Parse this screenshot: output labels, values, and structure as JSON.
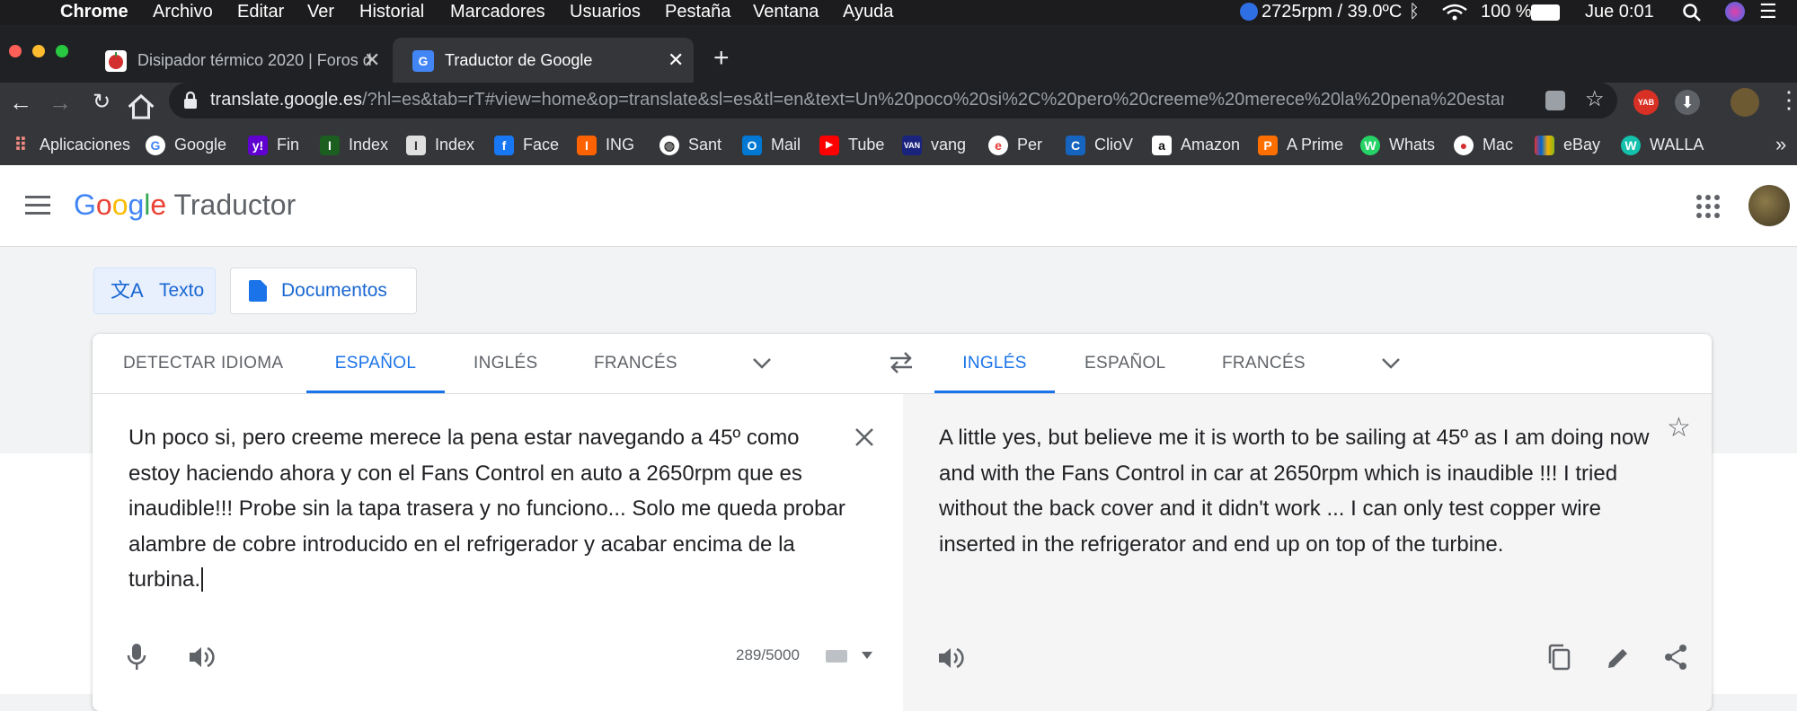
{
  "menubar": {
    "apple": "",
    "app": "Chrome",
    "items": [
      "Archivo",
      "Editar",
      "Ver",
      "Historial",
      "Marcadores",
      "Usuarios",
      "Pestaña",
      "Ventana",
      "Ayuda"
    ],
    "fan_status": "2725rpm / 39.0ºC",
    "battery": "100 %",
    "clock": "Jue 0:01"
  },
  "tabs": [
    {
      "title": "Disipador térmico 2020 | Foros d",
      "active": false
    },
    {
      "title": "Traductor de Google",
      "active": true
    }
  ],
  "address": {
    "host": "translate.google.es",
    "path": "/?hl=es&tab=rT#view=home&op=translate&sl=es&tl=en&text=Un%20poco%20si%2C%20pero%20creeme%20merece%20la%20pena%20estar..."
  },
  "bookmarks": [
    "Aplicaciones",
    "Google",
    "Fin",
    "Index",
    "Index",
    "Face",
    "ING",
    "Sant",
    "Mail",
    "Tube",
    "vang",
    "Per",
    "ClioV",
    "Amazon",
    "A Prime",
    "Whats",
    "Mac",
    "eBay",
    "WALLA"
  ],
  "google": {
    "logo": "Google",
    "product": "Traductor"
  },
  "modes": {
    "text": "Texto",
    "documents": "Documentos"
  },
  "source_langs": [
    "DETECTAR IDIOMA",
    "ESPAÑOL",
    "INGLÉS",
    "FRANCÉS"
  ],
  "target_langs": [
    "INGLÉS",
    "ESPAÑOL",
    "FRANCÉS"
  ],
  "source_text": "Un poco si, pero creeme merece la pena estar navegando a 45º como estoy haciendo ahora y con el Fans Control en auto a 2650rpm que es inaudible!!! Probe sin la tapa trasera y no funciono... Solo me queda probar alambre de cobre introducido en el refrigerador y acabar encima de la turbina.",
  "char_count": "289/5000",
  "translated_text": "A little yes, but believe me it is worth to be sailing at 45º as I am doing now and with the Fans Control in car at 2650rpm which is inaudible !!! I tried without the back cover and it didn't work ... I can only test copper wire inserted in the refrigerator and end up on top of the turbine."
}
